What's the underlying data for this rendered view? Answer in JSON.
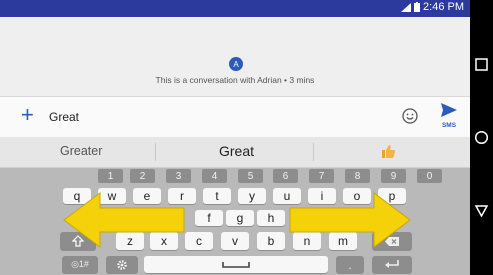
{
  "status": {
    "time": "2:46 PM"
  },
  "conversation": {
    "avatar_letter": "A",
    "info": "This is a conversation with Adrian • 3 mins"
  },
  "compose": {
    "value": "Great",
    "send_label": "SMS"
  },
  "suggestions": [
    "Greater",
    "Great"
  ],
  "keyboard": {
    "numbers": [
      "1",
      "2",
      "3",
      "4",
      "5",
      "6",
      "7",
      "8",
      "9",
      "0"
    ],
    "row1": [
      "q",
      "w",
      "e",
      "r",
      "t",
      "y",
      "u",
      "i",
      "o",
      "p"
    ],
    "row2": [
      "f",
      "g",
      "h"
    ],
    "row3": [
      "z",
      "x",
      "c",
      "v",
      "b",
      "n",
      "m"
    ],
    "symbols_label": "◎1#"
  },
  "colors": {
    "statusbar": "#2b3a9c",
    "accent": "#2b5bbd",
    "overlay_arrow": "#f5d10a"
  }
}
